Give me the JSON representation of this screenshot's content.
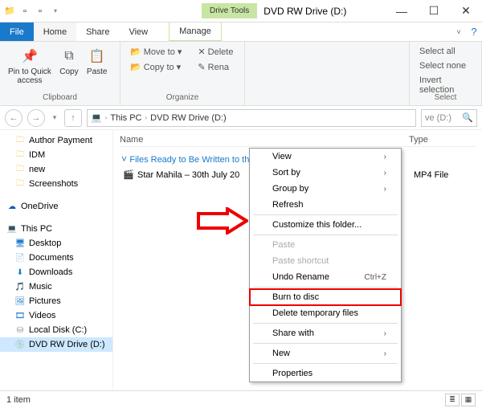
{
  "titlebar": {
    "tools_label": "Drive Tools",
    "title": "DVD RW Drive (D:)"
  },
  "tabs": {
    "file": "File",
    "home": "Home",
    "share": "Share",
    "view": "View",
    "manage": "Manage"
  },
  "ribbon": {
    "clipboard": {
      "label": "Clipboard",
      "pin": "Pin to Quick\naccess",
      "copy": "Copy",
      "paste": "Paste"
    },
    "organize": {
      "label": "Organize",
      "move": "Move to ▾",
      "copy": "Copy to ▾",
      "delete": "Delete",
      "rename": "Rena"
    },
    "select": {
      "label": "Select",
      "all": "Select all",
      "none": "Select none",
      "invert": "Invert selection"
    }
  },
  "address": {
    "root": "This PC",
    "loc": "DVD RW Drive (D:)",
    "search_ph": "ve (D:)"
  },
  "nav": {
    "items": [
      {
        "label": "Author Payment",
        "icon": "folder"
      },
      {
        "label": "IDM",
        "icon": "folder"
      },
      {
        "label": "new",
        "icon": "folder"
      },
      {
        "label": "Screenshots",
        "icon": "folder"
      }
    ],
    "onedrive": "OneDrive",
    "thispc": "This PC",
    "pc_items": [
      {
        "label": "Desktop",
        "icon": "desktop"
      },
      {
        "label": "Documents",
        "icon": "doc"
      },
      {
        "label": "Downloads",
        "icon": "down"
      },
      {
        "label": "Music",
        "icon": "music"
      },
      {
        "label": "Pictures",
        "icon": "pic"
      },
      {
        "label": "Videos",
        "icon": "vid"
      },
      {
        "label": "Local Disk (C:)",
        "icon": "drive"
      },
      {
        "label": "DVD RW Drive (D:)",
        "icon": "dvd",
        "selected": true
      }
    ]
  },
  "main": {
    "col_name": "Name",
    "col_type": "Type",
    "group": "Files Ready to Be Written to the Disc",
    "file": {
      "name": "Star Mahila – 30th July 20",
      "type": "MP4 File"
    }
  },
  "ctx": {
    "view": "View",
    "sort": "Sort by",
    "group": "Group by",
    "refresh": "Refresh",
    "customize": "Customize this folder...",
    "paste": "Paste",
    "paste_sc": "Paste shortcut",
    "undo": "Undo Rename",
    "undo_key": "Ctrl+Z",
    "burn": "Burn to disc",
    "deltemp": "Delete temporary files",
    "share": "Share with",
    "new": "New",
    "prop": "Properties"
  },
  "status": {
    "count": "1 item"
  }
}
